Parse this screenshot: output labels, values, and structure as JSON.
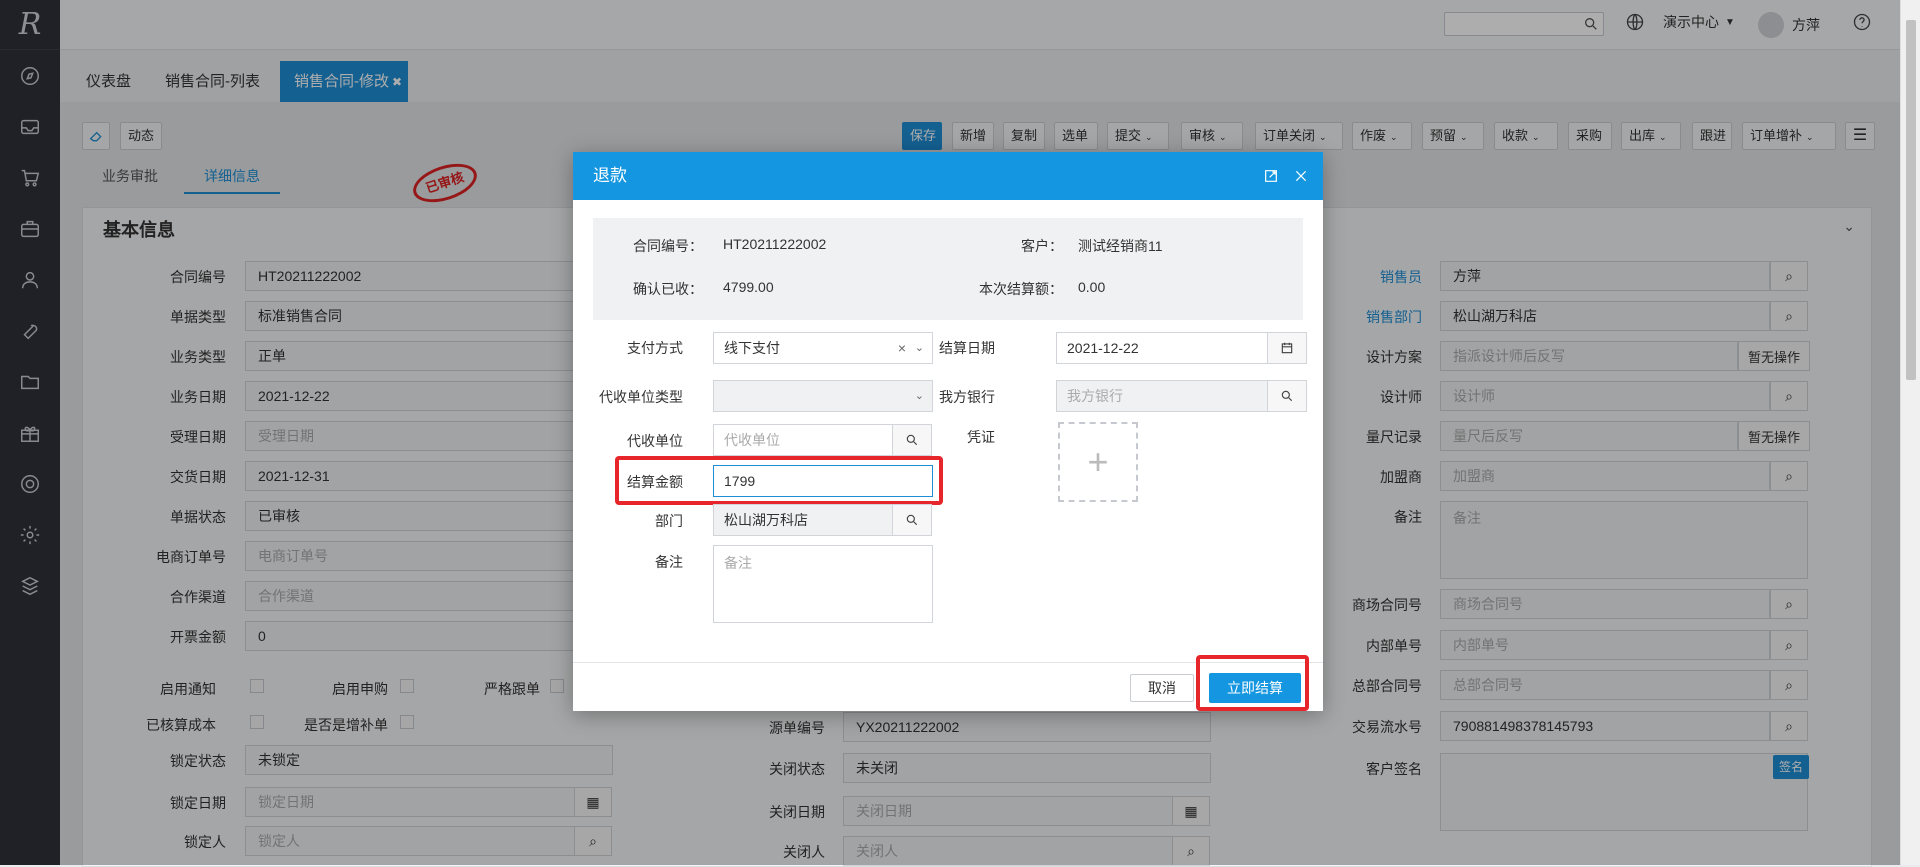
{
  "app": {
    "logo": "R",
    "search_placeholder": "",
    "env_label": "演示中心",
    "user_name": "方萍"
  },
  "colors": {
    "primary": "#1e8ed6",
    "highlight": "#e6262a",
    "sidebar": "#2e3138"
  },
  "tabs": [
    {
      "label": "仪表盘"
    },
    {
      "label": "销售合同-列表"
    },
    {
      "label": "销售合同-修改",
      "close": "✖"
    }
  ],
  "toolbar": {
    "left": [
      "动态"
    ],
    "buttons": [
      {
        "label": "保存",
        "primary": true
      },
      {
        "label": "新增"
      },
      {
        "label": "复制"
      },
      {
        "label": "选单"
      },
      {
        "label": "提交",
        "caret": true
      },
      {
        "label": "审核",
        "caret": true
      },
      {
        "label": "订单关闭",
        "caret": true
      },
      {
        "label": "作废",
        "caret": true
      },
      {
        "label": "预留",
        "caret": true
      },
      {
        "label": "收款",
        "caret": true
      },
      {
        "label": "采购"
      },
      {
        "label": "出库",
        "caret": true
      },
      {
        "label": "跟进"
      },
      {
        "label": "订单增补",
        "caret": true
      }
    ]
  },
  "subtabs": [
    "业务审批",
    "详细信息"
  ],
  "stamp": "已审核",
  "panel": {
    "title": "基本信息",
    "col1": [
      {
        "label": "合同编号",
        "value": "HT20211222002"
      },
      {
        "label": "单据类型",
        "value": "标准销售合同"
      },
      {
        "label": "业务类型",
        "value": "正单"
      },
      {
        "label": "业务日期",
        "value": "2021-12-22"
      },
      {
        "label": "受理日期",
        "placeholder": "受理日期"
      },
      {
        "label": "交货日期",
        "value": "2021-12-31"
      },
      {
        "label": "单据状态",
        "value": "已审核"
      },
      {
        "label": "电商订单号",
        "placeholder": "电商订单号"
      },
      {
        "label": "合作渠道",
        "placeholder": "合作渠道"
      },
      {
        "label": "开票金额",
        "value": "0"
      }
    ],
    "checks_row1": [
      "启用通知",
      "启用申购",
      "严格跟单"
    ],
    "checks_row2": [
      "已核算成本",
      "是否是增补单"
    ],
    "col1_bottom": [
      {
        "label": "锁定状态",
        "value": "未锁定"
      },
      {
        "label": "锁定日期",
        "placeholder": "锁定日期"
      },
      {
        "label": "锁定人",
        "placeholder": "锁定人"
      }
    ],
    "col2_bottom": [
      {
        "label": "源单编号",
        "value": "YX20211222002"
      },
      {
        "label": "关闭状态",
        "value": "未关闭"
      },
      {
        "label": "关闭日期",
        "placeholder": "关闭日期"
      },
      {
        "label": "关闭人",
        "placeholder": "关闭人"
      }
    ],
    "col3": [
      {
        "label": "销售员",
        "value": "方萍"
      },
      {
        "label": "销售部门",
        "value": "松山湖万科店"
      },
      {
        "label": "设计方案",
        "placeholder": "指派设计师后反写",
        "action": "暂无操作"
      },
      {
        "label": "设计师",
        "placeholder": "设计师"
      },
      {
        "label": "量尺记录",
        "placeholder": "量尺后反写",
        "action": "暂无操作"
      },
      {
        "label": "加盟商",
        "placeholder": "加盟商"
      },
      {
        "label": "备注",
        "placeholder": "备注"
      },
      {
        "label": "商场合同号",
        "placeholder": "商场合同号"
      },
      {
        "label": "内部单号",
        "placeholder": "内部单号"
      },
      {
        "label": "总部合同号",
        "placeholder": "总部合同号"
      },
      {
        "label": "交易流水号",
        "value": "790881498378145793"
      },
      {
        "label": "客户签名",
        "action": "签名"
      }
    ]
  },
  "dialog": {
    "title": "退款",
    "summary": {
      "contract_label": "合同编号：",
      "contract": "HT20211222002",
      "customer_label": "客户：",
      "customer": "测试经销商11",
      "received_label": "确认已收：",
      "received": "4799.00",
      "settle_label": "本次结算额：",
      "settle": "0.00"
    },
    "pay_method_label": "支付方式",
    "pay_method": "线下支付",
    "settle_date_label": "结算日期",
    "settle_date": "2021-12-22",
    "agent_type_label": "代收单位类型",
    "our_bank_label": "我方银行",
    "our_bank_placeholder": "我方银行",
    "agent_label": "代收单位",
    "agent_placeholder": "代收单位",
    "voucher_label": "凭证",
    "amount_label": "结算金额",
    "amount": "1799",
    "dept_label": "部门",
    "dept": "松山湖万科店",
    "note_label": "备注",
    "note_placeholder": "备注",
    "cancel": "取消",
    "submit": "立即结算"
  }
}
